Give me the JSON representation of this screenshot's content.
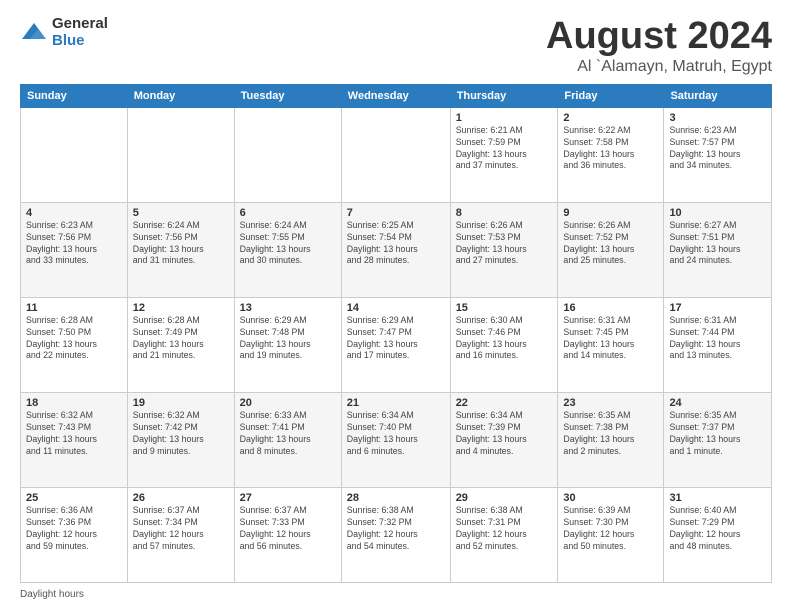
{
  "logo": {
    "general": "General",
    "blue": "Blue"
  },
  "title": "August 2024",
  "location": "Al `Alamayn, Matruh, Egypt",
  "weekdays": [
    "Sunday",
    "Monday",
    "Tuesday",
    "Wednesday",
    "Thursday",
    "Friday",
    "Saturday"
  ],
  "footer": "Daylight hours",
  "weeks": [
    [
      {
        "day": "",
        "info": ""
      },
      {
        "day": "",
        "info": ""
      },
      {
        "day": "",
        "info": ""
      },
      {
        "day": "",
        "info": ""
      },
      {
        "day": "1",
        "info": "Sunrise: 6:21 AM\nSunset: 7:59 PM\nDaylight: 13 hours\nand 37 minutes."
      },
      {
        "day": "2",
        "info": "Sunrise: 6:22 AM\nSunset: 7:58 PM\nDaylight: 13 hours\nand 36 minutes."
      },
      {
        "day": "3",
        "info": "Sunrise: 6:23 AM\nSunset: 7:57 PM\nDaylight: 13 hours\nand 34 minutes."
      }
    ],
    [
      {
        "day": "4",
        "info": "Sunrise: 6:23 AM\nSunset: 7:56 PM\nDaylight: 13 hours\nand 33 minutes."
      },
      {
        "day": "5",
        "info": "Sunrise: 6:24 AM\nSunset: 7:56 PM\nDaylight: 13 hours\nand 31 minutes."
      },
      {
        "day": "6",
        "info": "Sunrise: 6:24 AM\nSunset: 7:55 PM\nDaylight: 13 hours\nand 30 minutes."
      },
      {
        "day": "7",
        "info": "Sunrise: 6:25 AM\nSunset: 7:54 PM\nDaylight: 13 hours\nand 28 minutes."
      },
      {
        "day": "8",
        "info": "Sunrise: 6:26 AM\nSunset: 7:53 PM\nDaylight: 13 hours\nand 27 minutes."
      },
      {
        "day": "9",
        "info": "Sunrise: 6:26 AM\nSunset: 7:52 PM\nDaylight: 13 hours\nand 25 minutes."
      },
      {
        "day": "10",
        "info": "Sunrise: 6:27 AM\nSunset: 7:51 PM\nDaylight: 13 hours\nand 24 minutes."
      }
    ],
    [
      {
        "day": "11",
        "info": "Sunrise: 6:28 AM\nSunset: 7:50 PM\nDaylight: 13 hours\nand 22 minutes."
      },
      {
        "day": "12",
        "info": "Sunrise: 6:28 AM\nSunset: 7:49 PM\nDaylight: 13 hours\nand 21 minutes."
      },
      {
        "day": "13",
        "info": "Sunrise: 6:29 AM\nSunset: 7:48 PM\nDaylight: 13 hours\nand 19 minutes."
      },
      {
        "day": "14",
        "info": "Sunrise: 6:29 AM\nSunset: 7:47 PM\nDaylight: 13 hours\nand 17 minutes."
      },
      {
        "day": "15",
        "info": "Sunrise: 6:30 AM\nSunset: 7:46 PM\nDaylight: 13 hours\nand 16 minutes."
      },
      {
        "day": "16",
        "info": "Sunrise: 6:31 AM\nSunset: 7:45 PM\nDaylight: 13 hours\nand 14 minutes."
      },
      {
        "day": "17",
        "info": "Sunrise: 6:31 AM\nSunset: 7:44 PM\nDaylight: 13 hours\nand 13 minutes."
      }
    ],
    [
      {
        "day": "18",
        "info": "Sunrise: 6:32 AM\nSunset: 7:43 PM\nDaylight: 13 hours\nand 11 minutes."
      },
      {
        "day": "19",
        "info": "Sunrise: 6:32 AM\nSunset: 7:42 PM\nDaylight: 13 hours\nand 9 minutes."
      },
      {
        "day": "20",
        "info": "Sunrise: 6:33 AM\nSunset: 7:41 PM\nDaylight: 13 hours\nand 8 minutes."
      },
      {
        "day": "21",
        "info": "Sunrise: 6:34 AM\nSunset: 7:40 PM\nDaylight: 13 hours\nand 6 minutes."
      },
      {
        "day": "22",
        "info": "Sunrise: 6:34 AM\nSunset: 7:39 PM\nDaylight: 13 hours\nand 4 minutes."
      },
      {
        "day": "23",
        "info": "Sunrise: 6:35 AM\nSunset: 7:38 PM\nDaylight: 13 hours\nand 2 minutes."
      },
      {
        "day": "24",
        "info": "Sunrise: 6:35 AM\nSunset: 7:37 PM\nDaylight: 13 hours\nand 1 minute."
      }
    ],
    [
      {
        "day": "25",
        "info": "Sunrise: 6:36 AM\nSunset: 7:36 PM\nDaylight: 12 hours\nand 59 minutes."
      },
      {
        "day": "26",
        "info": "Sunrise: 6:37 AM\nSunset: 7:34 PM\nDaylight: 12 hours\nand 57 minutes."
      },
      {
        "day": "27",
        "info": "Sunrise: 6:37 AM\nSunset: 7:33 PM\nDaylight: 12 hours\nand 56 minutes."
      },
      {
        "day": "28",
        "info": "Sunrise: 6:38 AM\nSunset: 7:32 PM\nDaylight: 12 hours\nand 54 minutes."
      },
      {
        "day": "29",
        "info": "Sunrise: 6:38 AM\nSunset: 7:31 PM\nDaylight: 12 hours\nand 52 minutes."
      },
      {
        "day": "30",
        "info": "Sunrise: 6:39 AM\nSunset: 7:30 PM\nDaylight: 12 hours\nand 50 minutes."
      },
      {
        "day": "31",
        "info": "Sunrise: 6:40 AM\nSunset: 7:29 PM\nDaylight: 12 hours\nand 48 minutes."
      }
    ]
  ]
}
